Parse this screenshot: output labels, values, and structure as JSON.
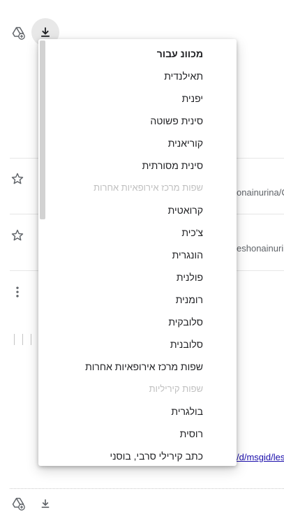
{
  "page": {
    "top_toolbar": {
      "add_to_drive_icon": "add-to-drive-icon",
      "download_icon": "download-icon"
    },
    "rows": [
      {
        "star_icon": "star-icon",
        "link_fragment": "onainurina/C"
      },
      {
        "star_icon": "star-icon",
        "link_fragment": "eshonainurin"
      }
    ],
    "more_icon": "more-vert-icon",
    "bottom_link_fragment": "/d/msgid/les",
    "bottom_toolbar": {
      "add_to_drive_icon": "add-to-drive-icon",
      "download_icon": "download-icon"
    }
  },
  "menu": {
    "items": [
      {
        "label": "מכוונ עבור",
        "kind": "header"
      },
      {
        "label": "תאילנדית",
        "kind": "item"
      },
      {
        "label": "יפנית",
        "kind": "item"
      },
      {
        "label": "סינית פשוטה",
        "kind": "item"
      },
      {
        "label": "קוריאנית",
        "kind": "item"
      },
      {
        "label": "סינית מסורתית",
        "kind": "item"
      },
      {
        "label": "שפות מרכז אירופאיות אחרות",
        "kind": "group"
      },
      {
        "label": "קרואטית",
        "kind": "item"
      },
      {
        "label": "צ'כית",
        "kind": "item"
      },
      {
        "label": "הונגרית",
        "kind": "item"
      },
      {
        "label": "פולנית",
        "kind": "item"
      },
      {
        "label": "רומנית",
        "kind": "item"
      },
      {
        "label": "סלובקית",
        "kind": "item"
      },
      {
        "label": "סלובנית",
        "kind": "item"
      },
      {
        "label": "שפות מרכז אירופאיות אחרות",
        "kind": "item"
      },
      {
        "label": "שפות קיריליות",
        "kind": "group"
      },
      {
        "label": "בולגרית",
        "kind": "item"
      },
      {
        "label": "רוסית",
        "kind": "item"
      },
      {
        "label": "כתב קירילי סרבי, בוסני",
        "kind": "item"
      }
    ]
  },
  "colors": {
    "icon": "#5f6368",
    "download_active_bg": "#e8e8e8",
    "link": "#1a0dab",
    "group_header": "#c0c0c0"
  }
}
